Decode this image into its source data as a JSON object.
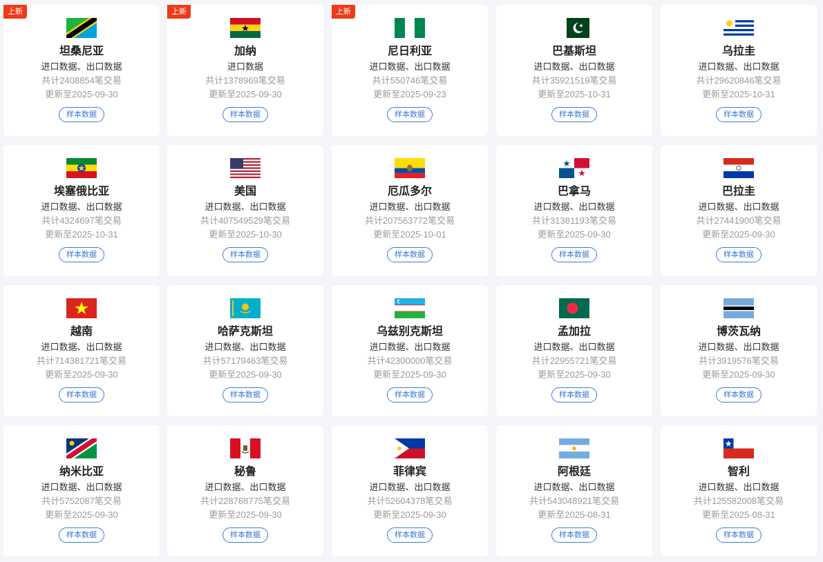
{
  "badge_new": "上新",
  "sample_label": "样本数据",
  "countries": [
    {
      "name": "坦桑尼亚",
      "types": "进口数据、出口数据",
      "count": "共计2408854笔交易",
      "updated": "更新至2025-09-30",
      "is_new": true,
      "flag_icon": "tanzania-flag-icon"
    },
    {
      "name": "加纳",
      "types": "进口数据",
      "count": "共计1378969笔交易",
      "updated": "更新至2025-09-30",
      "is_new": true,
      "flag_icon": "ghana-flag-icon"
    },
    {
      "name": "尼日利亚",
      "types": "进口数据、出口数据",
      "count": "共计550746笔交易",
      "updated": "更新至2025-09-23",
      "is_new": true,
      "flag_icon": "nigeria-flag-icon"
    },
    {
      "name": "巴基斯坦",
      "types": "进口数据、出口数据",
      "count": "共计35921519笔交易",
      "updated": "更新至2025-10-31",
      "is_new": false,
      "flag_icon": "pakistan-flag-icon"
    },
    {
      "name": "乌拉圭",
      "types": "进口数据、出口数据",
      "count": "共计29620846笔交易",
      "updated": "更新至2025-10-31",
      "is_new": false,
      "flag_icon": "uruguay-flag-icon"
    },
    {
      "name": "埃塞俄比亚",
      "types": "进口数据、出口数据",
      "count": "共计4324697笔交易",
      "updated": "更新至2025-10-31",
      "is_new": false,
      "flag_icon": "ethiopia-flag-icon"
    },
    {
      "name": "美国",
      "types": "进口数据、出口数据",
      "count": "共计407549529笔交易",
      "updated": "更新至2025-10-30",
      "is_new": false,
      "flag_icon": "usa-flag-icon"
    },
    {
      "name": "厄瓜多尔",
      "types": "进口数据、出口数据",
      "count": "共计207563772笔交易",
      "updated": "更新至2025-10-01",
      "is_new": false,
      "flag_icon": "ecuador-flag-icon"
    },
    {
      "name": "巴拿马",
      "types": "进口数据、出口数据",
      "count": "共计31381193笔交易",
      "updated": "更新至2025-09-30",
      "is_new": false,
      "flag_icon": "panama-flag-icon"
    },
    {
      "name": "巴拉圭",
      "types": "进口数据、出口数据",
      "count": "共计27441900笔交易",
      "updated": "更新至2025-09-30",
      "is_new": false,
      "flag_icon": "paraguay-flag-icon"
    },
    {
      "name": "越南",
      "types": "进口数据、出口数据",
      "count": "共计714381721笔交易",
      "updated": "更新至2025-09-30",
      "is_new": false,
      "flag_icon": "vietnam-flag-icon"
    },
    {
      "name": "哈萨克斯坦",
      "types": "进口数据、出口数据",
      "count": "共计57179463笔交易",
      "updated": "更新至2025-09-30",
      "is_new": false,
      "flag_icon": "kazakhstan-flag-icon"
    },
    {
      "name": "乌兹别克斯坦",
      "types": "进口数据、出口数据",
      "count": "共计42300000笔交易",
      "updated": "更新至2025-09-30",
      "is_new": false,
      "flag_icon": "uzbekistan-flag-icon"
    },
    {
      "name": "孟加拉",
      "types": "进口数据、出口数据",
      "count": "共计22955721笔交易",
      "updated": "更新至2025-09-30",
      "is_new": false,
      "flag_icon": "bangladesh-flag-icon"
    },
    {
      "name": "博茨瓦纳",
      "types": "进口数据、出口数据",
      "count": "共计3919576笔交易",
      "updated": "更新至2025-09-30",
      "is_new": false,
      "flag_icon": "botswana-flag-icon"
    },
    {
      "name": "纳米比亚",
      "types": "进口数据、出口数据",
      "count": "共计5752087笔交易",
      "updated": "更新至2025-09-30",
      "is_new": false,
      "flag_icon": "namibia-flag-icon"
    },
    {
      "name": "秘鲁",
      "types": "进口数据、出口数据",
      "count": "共计228788775笔交易",
      "updated": "更新至2025-09-30",
      "is_new": false,
      "flag_icon": "peru-flag-icon"
    },
    {
      "name": "菲律宾",
      "types": "进口数据、出口数据",
      "count": "共计52604378笔交易",
      "updated": "更新至2025-09-30",
      "is_new": false,
      "flag_icon": "philippines-flag-icon"
    },
    {
      "name": "阿根廷",
      "types": "进口数据、出口数据",
      "count": "共计543048921笔交易",
      "updated": "更新至2025-08-31",
      "is_new": false,
      "flag_icon": "argentina-flag-icon"
    },
    {
      "name": "智利",
      "types": "进口数据、出口数据",
      "count": "共计125582008笔交易",
      "updated": "更新至2025-08-31",
      "is_new": false,
      "flag_icon": "chile-flag-icon"
    }
  ],
  "colors": {
    "badge": "#f03a17",
    "accent": "#3a7bd5",
    "muted_text": "#9a9a9a",
    "background": "#f3f5f8"
  }
}
